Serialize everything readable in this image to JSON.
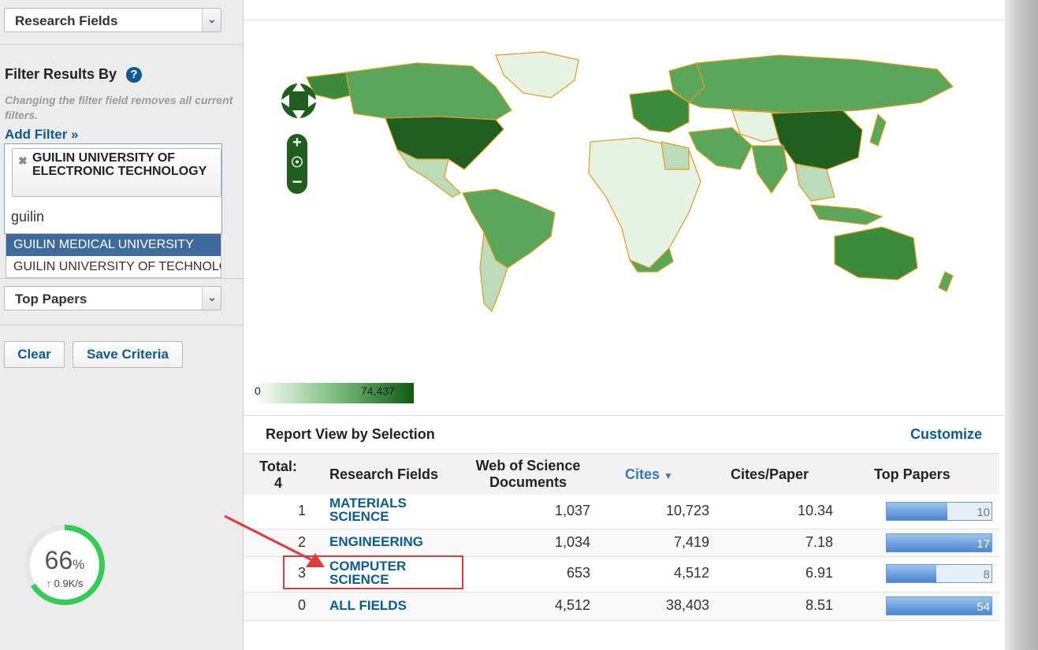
{
  "sidebar": {
    "research_fields_select": "Research Fields",
    "filter_title": "Filter Results By",
    "filter_note": "Changing the filter field removes all current filters.",
    "add_filter": "Add Filter »",
    "chip_label": "GUILIN UNIVERSITY OF ELECTRONIC TECHNOLOGY",
    "typed_value": "guilin",
    "suggestions": [
      "GUILIN MEDICAL UNIVERSITY",
      "GUILIN UNIVERSITY OF TECHNOLOGY"
    ],
    "top_papers_select": "Top Papers",
    "clear_button": "Clear",
    "save_button": "Save Criteria"
  },
  "speed_widget": {
    "percent": "66",
    "percent_sign": "%",
    "rate": "0.9K/s",
    "arrow": "↑",
    "progress": 0.66
  },
  "map": {
    "legend_min": "0",
    "legend_max": "74,437",
    "colors": {
      "darkest": "#1f5e1f",
      "dark": "#3c8a3c",
      "mid": "#5aa65a",
      "light": "#bcdcb9",
      "lightest": "#e6f2e2",
      "border": "#e39b1c"
    }
  },
  "report": {
    "title": "Report View by Selection",
    "customize": "Customize",
    "headers": {
      "total": "Total:",
      "total_count": "4",
      "field": "Research Fields",
      "docs": "Web of Science Documents",
      "cites": "Cites",
      "cites_paper": "Cites/Paper",
      "top_papers": "Top Papers"
    },
    "rows": [
      {
        "rank": "1",
        "field": "MATERIALS SCIENCE",
        "docs": "1,037",
        "cites": "10,723",
        "cpp": "10.34",
        "top": "10",
        "top_fill": 0.58
      },
      {
        "rank": "2",
        "field": "ENGINEERING",
        "docs": "1,034",
        "cites": "7,419",
        "cpp": "7.18",
        "top": "17",
        "top_fill": 1.0
      },
      {
        "rank": "3",
        "field": "COMPUTER SCIENCE",
        "docs": "653",
        "cites": "4,512",
        "cpp": "6.91",
        "top": "8",
        "top_fill": 0.47
      },
      {
        "rank": "0",
        "field": "ALL FIELDS",
        "docs": "4,512",
        "cites": "38,403",
        "cpp": "8.51",
        "top": "54",
        "top_fill": 1.0
      }
    ]
  }
}
